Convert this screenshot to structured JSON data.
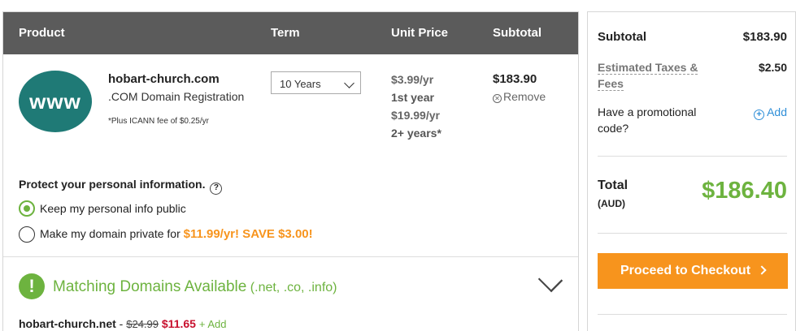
{
  "table": {
    "headers": {
      "product": "Product",
      "term": "Term",
      "unit_price": "Unit Price",
      "subtotal": "Subtotal"
    }
  },
  "item": {
    "logo_text": "www",
    "domain": "hobart-church.com",
    "type": ".COM Domain Registration",
    "icann_note": "*Plus ICANN fee of $0.25/yr",
    "term_value": "10 Years",
    "price_first": "$3.99/yr",
    "price_first_label": "1st year",
    "price_renew": "$19.99/yr",
    "price_renew_label": "2+ years*",
    "subtotal": "$183.90",
    "remove_label": "Remove"
  },
  "privacy": {
    "title": "Protect your personal information.",
    "help_icon": "?",
    "option_public": "Keep my personal info public",
    "option_private_prefix": "Make my domain private for ",
    "option_private_offer": "$11.99/yr! SAVE $3.00!"
  },
  "matching": {
    "icon": "!",
    "title": "Matching Domains Available",
    "tlds": " (.net, .co, .info)"
  },
  "suggestion": {
    "domain": "hobart-church.net",
    "separator": " - ",
    "old_price": "$24.99",
    "new_price": "$11.65",
    "add_label": "+ Add"
  },
  "summary": {
    "subtotal_label": "Subtotal",
    "subtotal_value": "$183.90",
    "taxes_label_line1": "Estimated Taxes &",
    "taxes_label_line2": "Fees",
    "taxes_value": "$2.50",
    "promo_line1": "Have a promotional",
    "promo_line2": "code?",
    "promo_add": "Add",
    "total_label": "Total",
    "currency": "(AUD)",
    "total_value": "$186.40",
    "checkout_label": "Proceed to Checkout"
  },
  "colors": {
    "accent_green": "#6db33f",
    "accent_orange": "#f7941d",
    "header_gray": "#5b5b5b",
    "link_blue": "#2f8fd8",
    "sale_red": "#c8102e"
  }
}
